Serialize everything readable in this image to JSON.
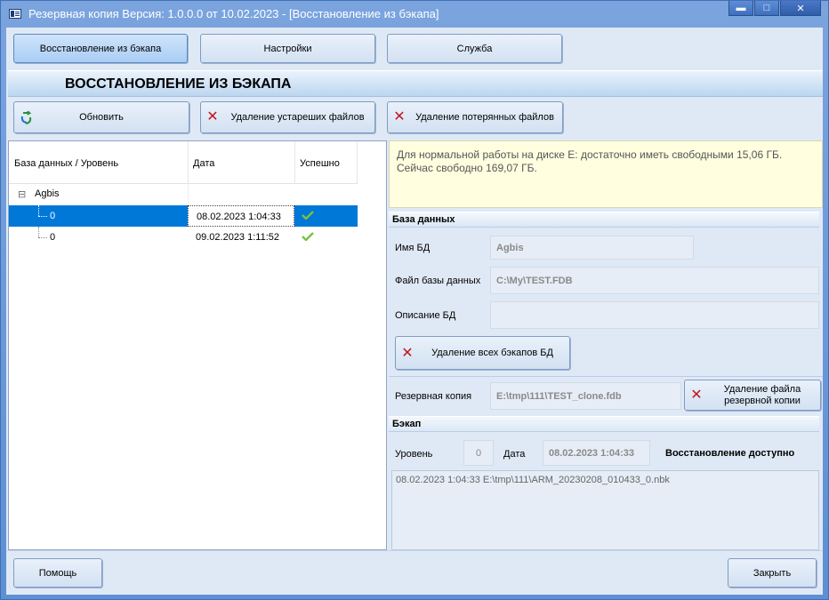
{
  "window": {
    "title": "Резервная копия   Версия: 1.0.0.0 от 10.02.2023 - [Восстановление из бэкапа]",
    "controls": {
      "minimize": "▬",
      "maximize": "□",
      "close": "✕"
    }
  },
  "tabs": [
    {
      "label": "Восстановление из бэкапа",
      "active": true
    },
    {
      "label": "Настройки",
      "active": false
    },
    {
      "label": "Служба",
      "active": false
    }
  ],
  "section_title": "ВОССТАНОВЛЕНИЕ ИЗ БЭКАПА",
  "toolbar": {
    "refresh_label": "Обновить",
    "delete_old_label": "Удаление устареших файлов",
    "delete_lost_label": "Удаление потерянных файлов"
  },
  "tree": {
    "columns": [
      "База данных / Уровень",
      "Дата",
      "Успешно"
    ],
    "root": {
      "name": "Agbis",
      "expander": "⊟"
    },
    "rows": [
      {
        "level": "0",
        "date": "08.02.2023 1:04:33",
        "success": true,
        "selected": true
      },
      {
        "level": "0",
        "date": "09.02.2023 1:11:52",
        "success": true,
        "selected": false
      }
    ]
  },
  "info": {
    "line1": "Для нормальной работы на диске E: достаточно иметь свободными 15,06 ГБ.",
    "line2": "Сейчас свободно 169,07 ГБ."
  },
  "database_group": {
    "title": "База данных",
    "name_label": "Имя БД",
    "name_value": "Agbis",
    "file_label": "Файл базы данных",
    "file_value": "C:\\My\\TEST.FDB",
    "description_label": "Описание БД",
    "description_value": "",
    "delete_all_label": "Удаление всех бэкапов БД"
  },
  "backup_copy": {
    "label": "Резервная копия",
    "value": "E:\\tmp\\111\\TEST_clone.fdb",
    "delete_file_label_line1": "Удаление файла",
    "delete_file_label_line2": "резервной копии"
  },
  "backup_group": {
    "title": "Бэкап",
    "level_label": "Уровень",
    "level_value": "0",
    "date_label": "Дата",
    "date_value": "08.02.2023 1:04:33",
    "status": "Восстановление доступно",
    "log": "08.02.2023 1:04:33 E:\\tmp\\111\\ARM_20230208_010433_0.nbk"
  },
  "footer": {
    "help_label": "Помощь",
    "close_label": "Закрыть"
  },
  "colors": {
    "selection": "#0078d7",
    "info_bg": "#ffffe0",
    "delete_icon": "#c4171c",
    "check_icon": "#7ac143"
  },
  "icons": {
    "refresh": "refresh-icon",
    "delete": "red-x-icon",
    "success": "checkmark-icon"
  }
}
